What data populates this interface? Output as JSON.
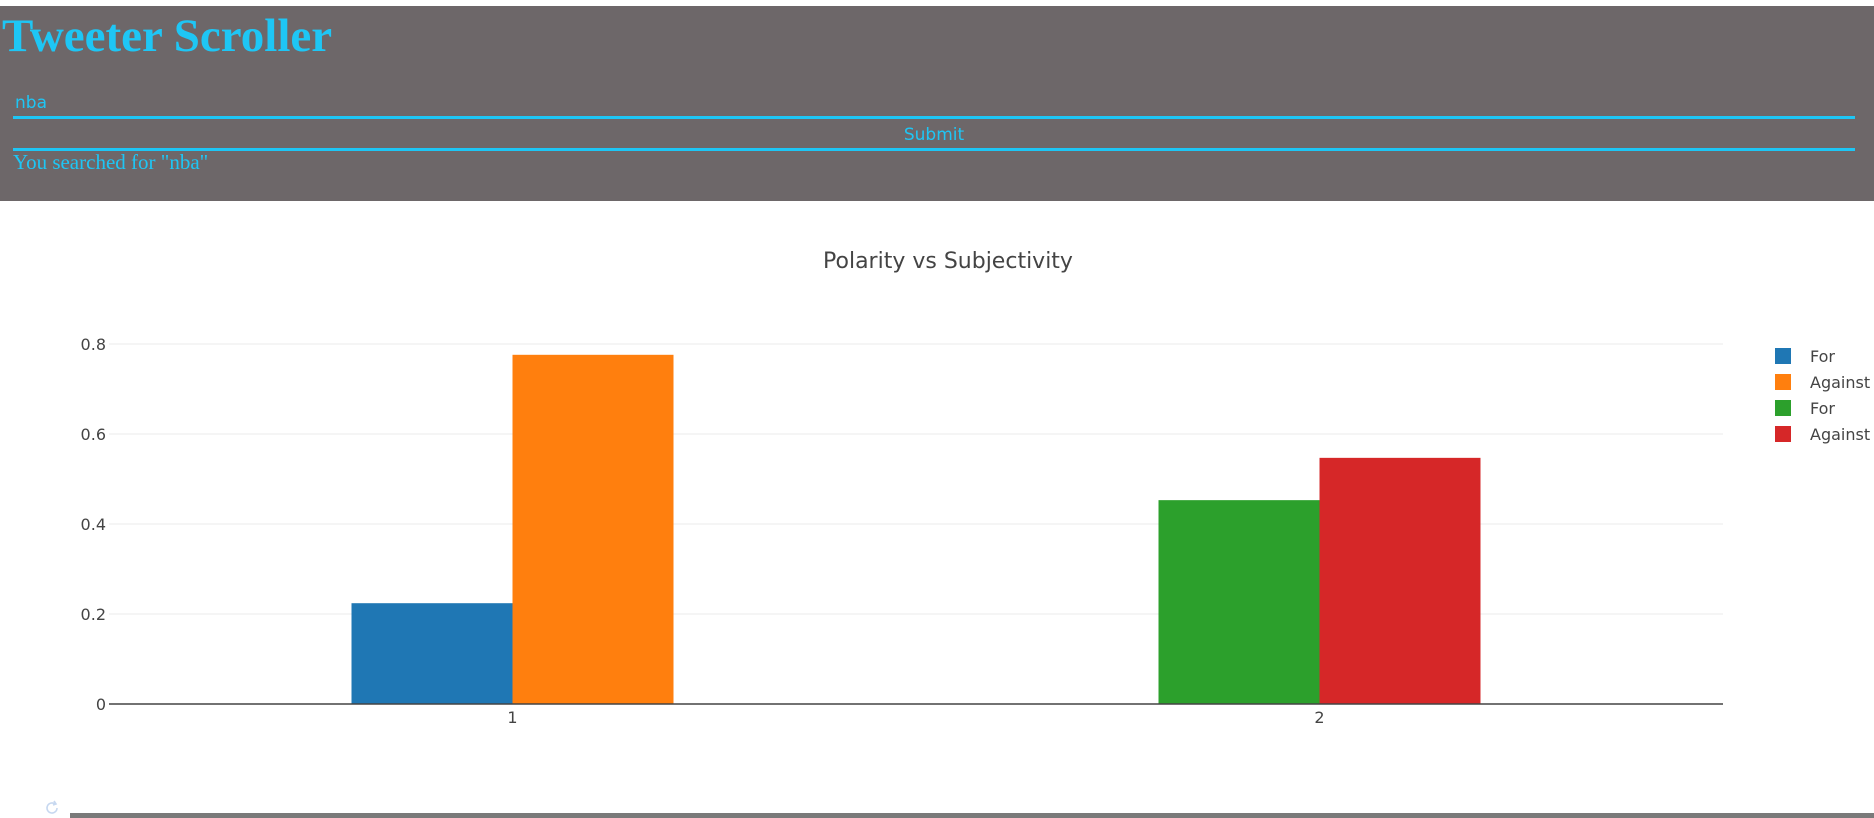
{
  "app": {
    "title": "Tweeter Scroller"
  },
  "search": {
    "value": "nba",
    "submit_label": "Submit",
    "feedback": "You searched for \"nba\""
  },
  "colors": {
    "header_bg": "#6d6769",
    "accent": "#1ec6f5"
  },
  "chart_data": {
    "type": "bar",
    "title": "Polarity vs Subjectivity",
    "xlabel": "",
    "ylabel": "",
    "categories": [
      "1",
      "2"
    ],
    "ylim": [
      0,
      0.8
    ],
    "yticks": [
      "0",
      "0.2",
      "0.4",
      "0.6",
      "0.8"
    ],
    "grid": true,
    "legend": "top-right",
    "series": [
      {
        "name": "For",
        "color": "#1f77b4",
        "values": [
          0.224,
          null
        ]
      },
      {
        "name": "Against",
        "color": "#ff7f0e",
        "values": [
          0.776,
          null
        ]
      },
      {
        "name": "For",
        "color": "#2ca02c",
        "values": [
          null,
          0.453
        ]
      },
      {
        "name": "Against",
        "color": "#d62728",
        "values": [
          null,
          0.547
        ]
      }
    ]
  }
}
